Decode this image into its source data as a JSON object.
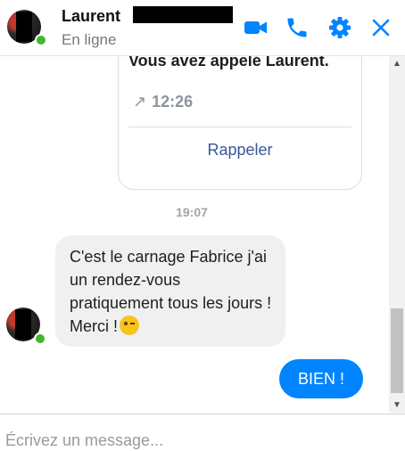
{
  "header": {
    "contact_name": "Laurent",
    "status": "En ligne"
  },
  "conversation": {
    "call_card": {
      "text": "Vous avez appelé Laurent.",
      "arrow": "↗",
      "time": "12:26",
      "callback_label": "Rappeler"
    },
    "timestamp": "19:07",
    "incoming_message": "C'est le carnage Fabrice j'ai un rendez-vous pratiquement tous les jours ! Merci !",
    "outgoing_message": "BIEN !"
  },
  "composer": {
    "placeholder": "Écrivez un message..."
  },
  "icons": {
    "video_call": "video-camera-icon",
    "voice_call": "phone-icon",
    "settings": "gear-icon",
    "close": "close-icon"
  },
  "colors": {
    "accent": "#0084ff",
    "online": "#42b72a",
    "link": "#385898"
  }
}
